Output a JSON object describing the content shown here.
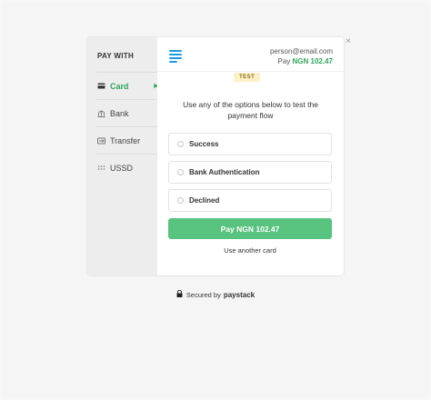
{
  "sidebar": {
    "title": "PAY WITH",
    "items": [
      {
        "label": "Card",
        "icon": "card-icon"
      },
      {
        "label": "Bank",
        "icon": "bank-icon"
      },
      {
        "label": "Transfer",
        "icon": "transfer-icon"
      },
      {
        "label": "USSD",
        "icon": "ussd-icon"
      }
    ],
    "active": "Card"
  },
  "header": {
    "email": "person@email.com",
    "pay_prefix": "Pay",
    "amount": "NGN 102.47"
  },
  "badge": "TEST",
  "description": "Use any of the options below to test the payment flow",
  "options": [
    {
      "label": "Success"
    },
    {
      "label": "Bank Authentication"
    },
    {
      "label": "Declined"
    }
  ],
  "pay_button": "Pay NGN 102.47",
  "alt_link": "Use another card",
  "footer": {
    "secured_text": "Secured by",
    "brand": "paystack"
  },
  "colors": {
    "accent": "#2fa85a",
    "button": "#58c27f",
    "logo": "#1a9be0",
    "badge_bg": "#fdf0c7"
  }
}
